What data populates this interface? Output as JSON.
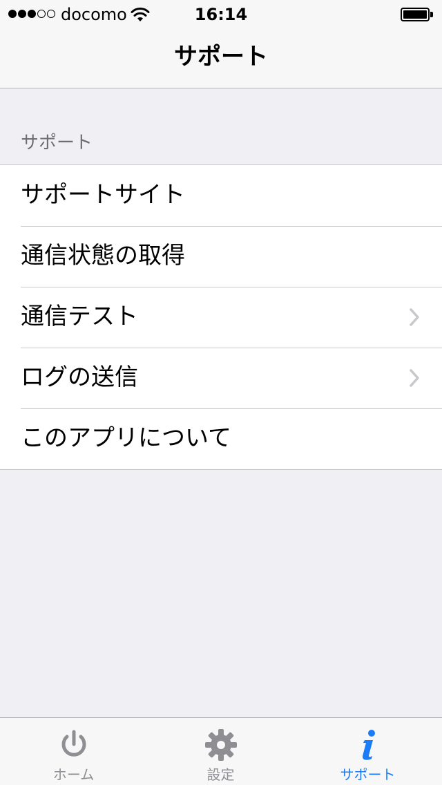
{
  "status_bar": {
    "carrier": "docomo",
    "time": "16:14",
    "signal_bars_filled": 3,
    "signal_bars_total": 5
  },
  "nav": {
    "title": "サポート"
  },
  "section": {
    "header": "サポート",
    "rows": [
      {
        "label": "サポートサイト",
        "chevron": false
      },
      {
        "label": "通信状態の取得",
        "chevron": false
      },
      {
        "label": "通信テスト",
        "chevron": true
      },
      {
        "label": "ログの送信",
        "chevron": true
      },
      {
        "label": "このアプリについて",
        "chevron": false
      }
    ]
  },
  "tabs": [
    {
      "label": "ホーム",
      "icon": "power-icon",
      "active": false
    },
    {
      "label": "設定",
      "icon": "gear-icon",
      "active": false
    },
    {
      "label": "サポート",
      "icon": "info-icon",
      "active": true
    }
  ],
  "colors": {
    "accent": "#1a7cf9",
    "inactive": "#8e8e93",
    "background": "#efeff4"
  }
}
